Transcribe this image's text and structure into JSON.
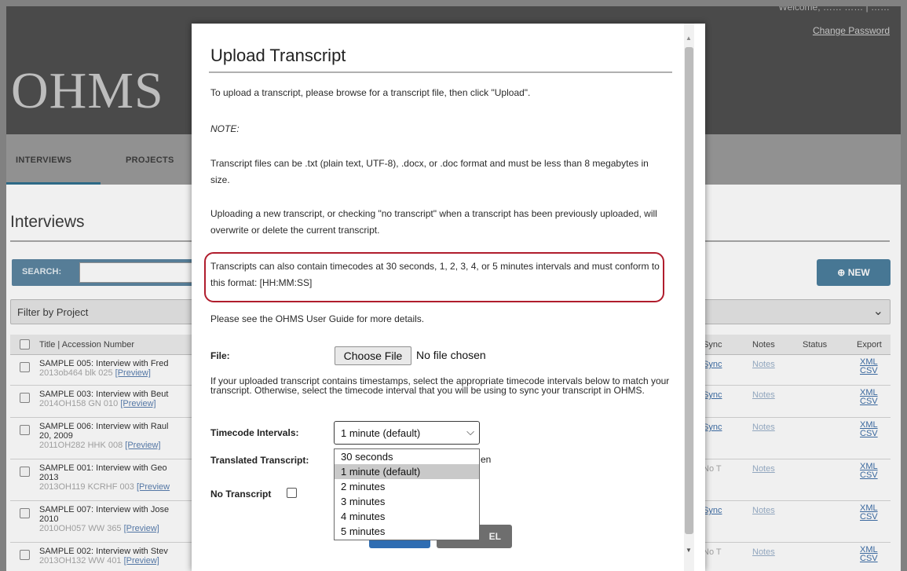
{
  "bg": {
    "logo": "OHMS",
    "welcome": "Welcome, ……   ……  |  ……",
    "change_password": "Change Password",
    "nav": [
      "INTERVIEWS",
      "PROJECTS"
    ],
    "page_title": "Interviews",
    "search_label": "SEARCH:",
    "new_button": "NEW",
    "filter_placeholder": "Filter by Project",
    "columns": {
      "title": "Title | Accession Number",
      "sync": "Sync",
      "notes": "Notes",
      "status": "Status",
      "export": "Export"
    },
    "rows": [
      {
        "title": "SAMPLE 005: Interview with Fred",
        "acc": "2013ob464 blk 025",
        "preview": "[Preview]",
        "sync": "Sync",
        "notes": "Notes",
        "xml": "XML",
        "csv": "CSV"
      },
      {
        "title": "SAMPLE 003: Interview with Beut",
        "acc": "2014OH158 GN 010",
        "preview": "[Preview]",
        "sync": "Sync",
        "notes": "Notes",
        "xml": "XML",
        "csv": "CSV"
      },
      {
        "title": "SAMPLE 006: Interview with Raul",
        "title2": "20, 2009",
        "acc": "2011OH282 HHK 008",
        "preview": "[Preview]",
        "sync": "Sync",
        "notes": "Notes",
        "xml": "XML",
        "csv": "CSV"
      },
      {
        "title": "SAMPLE 001: Interview with Geo",
        "title2": "2013",
        "acc": "2013OH119 KCRHF 003",
        "preview": "[Preview",
        "sync": "No T",
        "notes": "Notes",
        "xml": "XML",
        "csv": "CSV"
      },
      {
        "title": "SAMPLE 007: Interview with Jose",
        "title2": "2010",
        "acc": "2010OH057 WW 365",
        "preview": "[Preview]",
        "sync": "Sync",
        "notes": "Notes",
        "xml": "XML",
        "csv": "CSV"
      },
      {
        "title": "SAMPLE 002: Interview with Stev",
        "acc": "2013OH132 WW 401",
        "preview": "[Preview]",
        "sync": "No T",
        "notes": "Notes",
        "xml": "XML",
        "csv": "CSV"
      }
    ]
  },
  "dialog": {
    "title": "Upload Transcript",
    "intro": "To upload a transcript, please browse for a transcript file, then click \"Upload\".",
    "note": "NOTE:",
    "formats": "Transcript files can be .txt (plain text, UTF-8), .docx, or .doc format and must be less than 8 megabytes in size.",
    "overwrite": "Uploading a new transcript, or checking \"no transcript\" when a transcript has been previously uploaded, will overwrite or delete the current transcript.",
    "timecodes": "Transcripts can also contain timecodes at 30 seconds, 1, 2, 3, 4, or 5 minutes intervals and must conform to this format: [HH:MM:SS]",
    "guide": "Please see the OHMS User Guide for more details.",
    "file_label": "File:",
    "choose_file": "Choose File",
    "no_file": "No file chosen",
    "timestamps_help": "If your uploaded transcript contains timestamps, select the appropriate timecode intervals below to match your transcript. Otherwise, select the timecode interval that you will be using to sync your transcript in OHMS.",
    "timecode_label": "Timecode Intervals:",
    "timecode_value": "1 minute (default)",
    "translated_label": "Translated Transcript:",
    "translated_hint": "en",
    "no_transcript_label": "No Transcript",
    "cancel_partial": "EL",
    "options": [
      "30 seconds",
      "1 minute (default)",
      "2 minutes",
      "3 minutes",
      "4 minutes",
      "5 minutes"
    ],
    "selected_option_index": 1
  }
}
